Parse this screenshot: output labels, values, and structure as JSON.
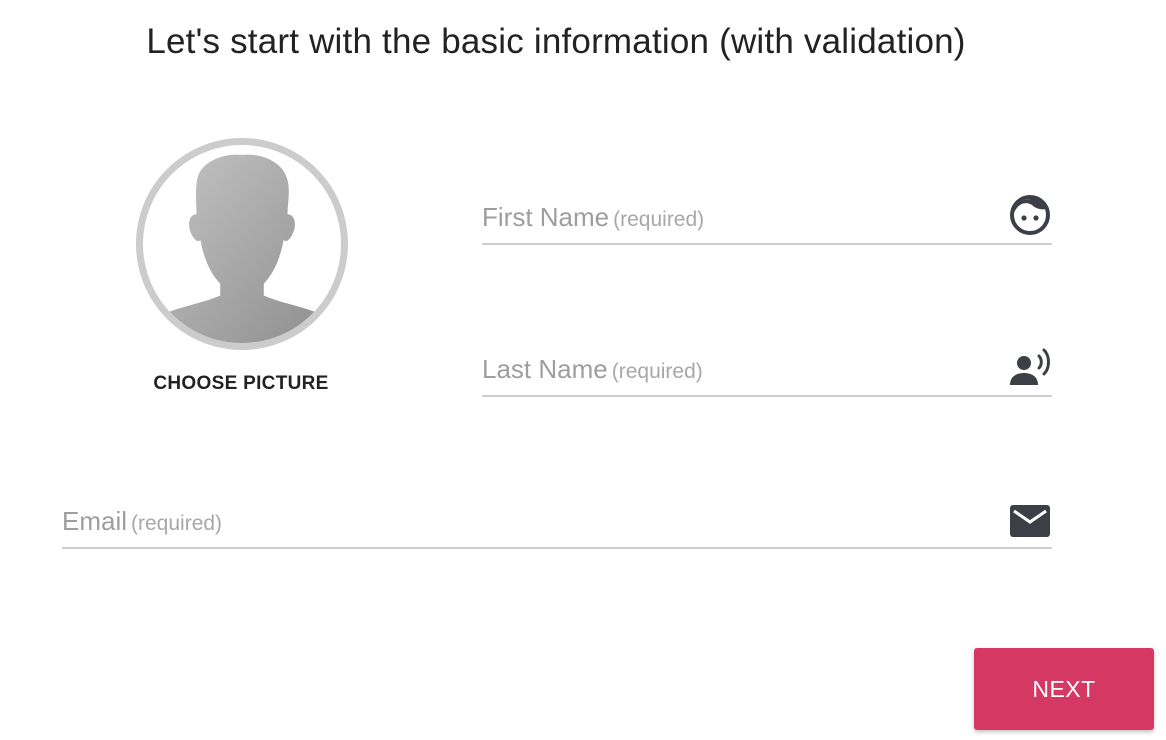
{
  "form": {
    "title": "Let's start with the basic information (with validation)",
    "avatar": {
      "icon": "person-silhouette-icon",
      "choose_label": "CHOOSE PICTURE"
    },
    "fields": {
      "first_name": {
        "label": "First Name",
        "hint": "(required)",
        "value": "",
        "icon": "face-icon"
      },
      "last_name": {
        "label": "Last Name",
        "hint": "(required)",
        "value": "",
        "icon": "record-voice-icon"
      },
      "email": {
        "label": "Email",
        "hint": "(required)",
        "value": "",
        "icon": "mail-icon"
      }
    },
    "next_label": "NEXT"
  },
  "colors": {
    "accent": "#d63864",
    "icon": "#3c4046",
    "underline": "#cfcfcf",
    "label": "#9e9e9e",
    "avatar_ring": "#cccccc"
  }
}
